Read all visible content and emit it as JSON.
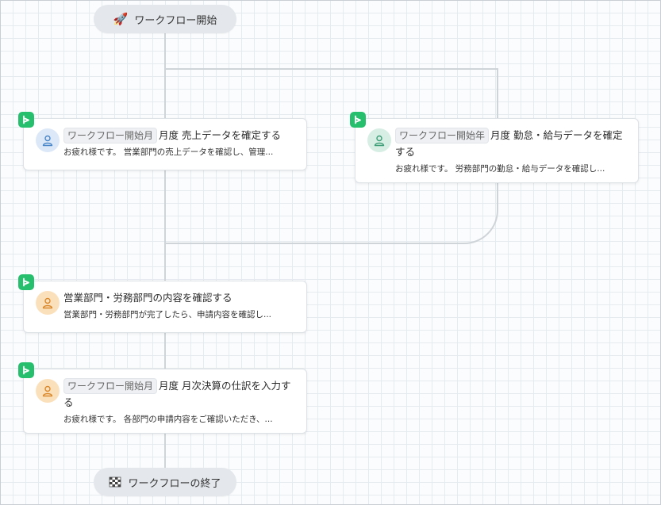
{
  "start": {
    "label": "ワークフロー開始",
    "icon": "rocket-icon",
    "emoji": "🚀"
  },
  "end": {
    "label": "ワークフローの終了",
    "icon": "checkered-flag-icon"
  },
  "tasks": [
    {
      "chip": "ワークフロー開始月",
      "title": "月度 売上データを確定する",
      "desc": "お疲れ様です。 営業部門の売上データを確認し、管理...",
      "avatar_color": "#dce8f7",
      "avatar_stroke": "#4a86c8"
    },
    {
      "chip": "ワークフロー開始年",
      "title": "月度 勤怠・給与データを確定する",
      "desc": "お疲れ様です。 労務部門の勤怠・給与データを確認し...",
      "avatar_color": "#d6eee4",
      "avatar_stroke": "#3f9e77"
    },
    {
      "chip": "",
      "title": "営業部門・労務部門の内容を確認する",
      "desc": "営業部門・労務部門が完了したら、申請内容を確認し...",
      "avatar_color": "#fbe0bc",
      "avatar_stroke": "#d9892c"
    },
    {
      "chip": "ワークフロー開始月",
      "title": "月度 月次決算の仕訳を入力する",
      "desc": "お疲れ様です。 各部門の申請内容をご確認いただき、...",
      "avatar_color": "#fbe0bc",
      "avatar_stroke": "#d9892c"
    }
  ],
  "colors": {
    "badge": "#26bf6e",
    "connector": "#cfd4d9"
  }
}
